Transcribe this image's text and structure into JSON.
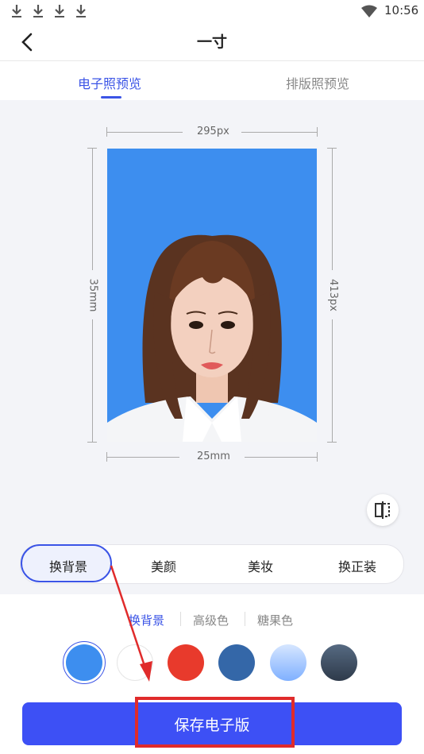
{
  "status_bar": {
    "time": "10:56",
    "icons": [
      "download-icon",
      "download-icon",
      "download-icon",
      "download-icon",
      "wifi-icon"
    ]
  },
  "header": {
    "title": "一寸",
    "back_icon": "chevron-left-icon"
  },
  "tabs": [
    {
      "label": "电子照预览",
      "active": true
    },
    {
      "label": "排版照预览",
      "active": false
    }
  ],
  "preview": {
    "width_px": "295px",
    "height_px": "413px",
    "width_mm": "25mm",
    "height_mm": "35mm",
    "background_color": "#3d8eef",
    "compare_icon": "compare-icon"
  },
  "function_tabs": [
    {
      "label": "换背景",
      "active": true
    },
    {
      "label": "美颜",
      "active": false
    },
    {
      "label": "美妆",
      "active": false
    },
    {
      "label": "换正装",
      "active": false
    }
  ],
  "sub_tabs": [
    {
      "label": "换背景",
      "active": true
    },
    {
      "label": "高级色",
      "active": false
    },
    {
      "label": "糖果色",
      "active": false
    }
  ],
  "swatches": [
    "#3d8eef",
    "#ffffff",
    "#e83a2c",
    "#3467a8",
    "#a8cbff",
    "#3b4a5e"
  ],
  "selected_swatch": 0,
  "save_button": {
    "label": "保存电子版"
  },
  "colors": {
    "accent": "#3b54e6",
    "annotation": "#e02b2b"
  }
}
